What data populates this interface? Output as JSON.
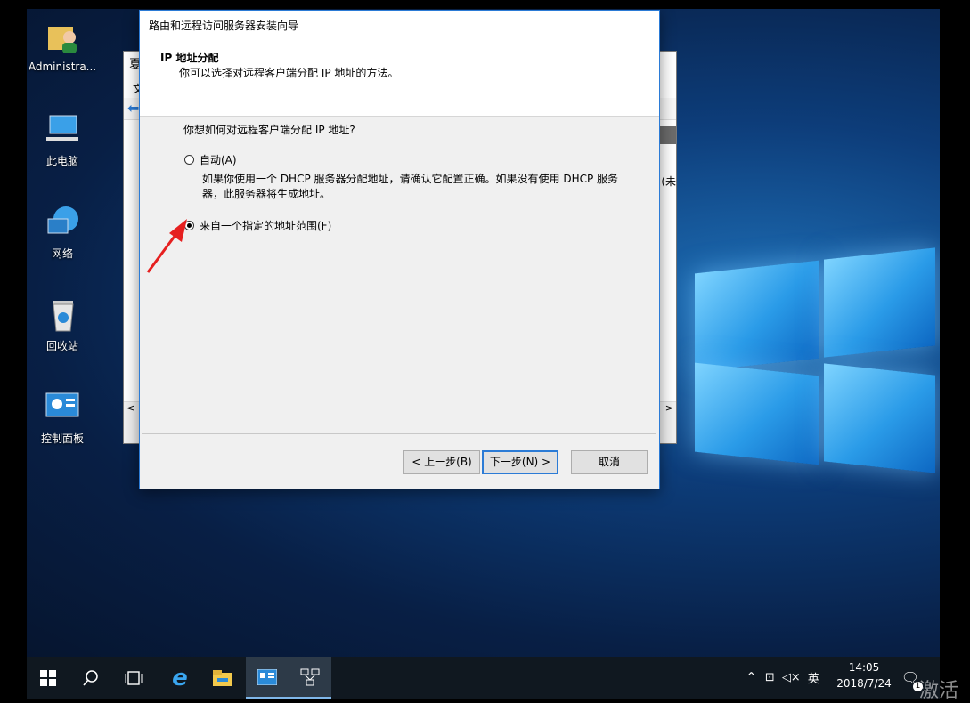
{
  "desktop": {
    "icons": [
      {
        "label": "Administra..."
      },
      {
        "label": "此电脑"
      },
      {
        "label": "网络"
      },
      {
        "label": "回收站"
      },
      {
        "label": "控制面板"
      }
    ]
  },
  "background_window": {
    "title_fragment": "夏",
    "menu_fragment": "文",
    "side_fragment": "匚 (未"
  },
  "wizard": {
    "title": "路由和远程访问服务器安装向导",
    "header_title": "IP 地址分配",
    "header_subtitle": "你可以选择对远程客户端分配 IP 地址的方法。",
    "question": "你想如何对远程客户端分配 IP 地址?",
    "option_auto_label": "自动(A)",
    "option_auto_desc": "如果你使用一个 DHCP 服务器分配地址，请确认它配置正确。如果没有使用 DHCP 服务器，此服务器将生成地址。",
    "option_range_label": "来自一个指定的地址范围(F)",
    "selected": "range",
    "back_label": "< 上一步(B)",
    "next_label": "下一步(N) >",
    "cancel_label": "取消"
  },
  "taskbar": {
    "input_indicator": "英",
    "time": "14:05",
    "date": "2018/7/24",
    "notification_count": "1"
  },
  "watermark": "激活"
}
